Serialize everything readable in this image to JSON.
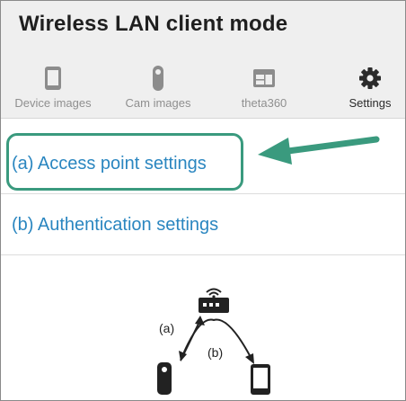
{
  "header": {
    "title": "Wireless LAN client mode"
  },
  "tabs": [
    {
      "label": "Device images",
      "icon": "smartphone-icon"
    },
    {
      "label": "Cam images",
      "icon": "camera-icon"
    },
    {
      "label": "theta360",
      "icon": "browser-window-icon"
    },
    {
      "label": "Settings",
      "icon": "gear-icon",
      "active": true
    }
  ],
  "settings": {
    "items": [
      {
        "label": "(a) Access point settings"
      },
      {
        "label": "(b) Authentication settings"
      }
    ]
  },
  "diagram": {
    "label_a": "(a)",
    "label_b": "(b)"
  },
  "colors": {
    "link": "#2a86c0",
    "highlight": "#3a9a7e",
    "header_bg": "#efefef"
  }
}
